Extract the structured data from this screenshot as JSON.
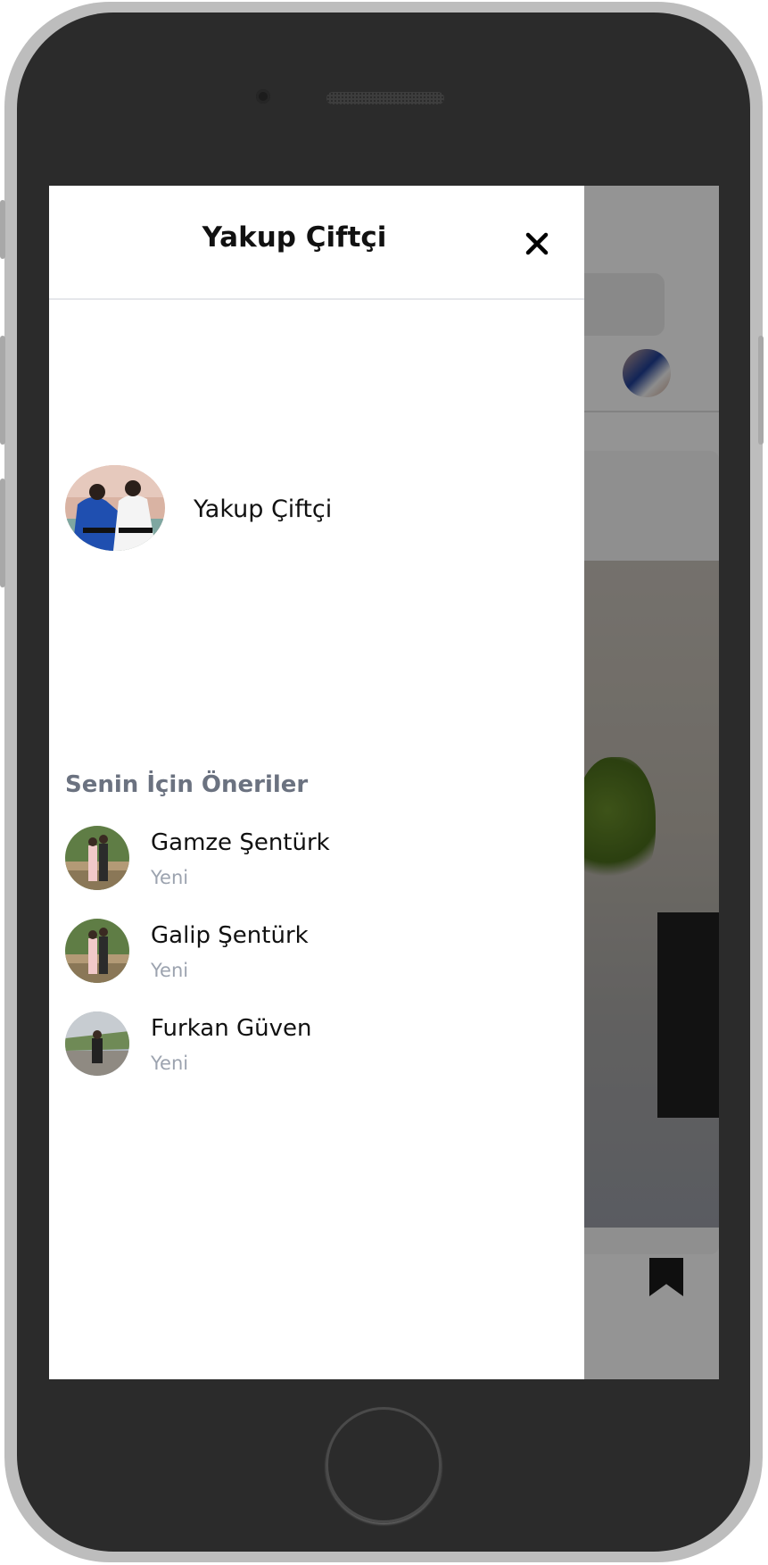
{
  "drawer": {
    "title": "Yakup Çiftçi",
    "close_icon": "close-icon"
  },
  "profile": {
    "name": "Yakup Çiftçi",
    "avatar": "judo-avatar"
  },
  "suggestions": {
    "title": "Senin İçin Öneriler",
    "items": [
      {
        "name": "Gamze Şentürk",
        "status": "Yeni"
      },
      {
        "name": "Galip Şentürk",
        "status": "Yeni"
      },
      {
        "name": "Furkan Güven",
        "status": "Yeni"
      }
    ]
  },
  "background": {
    "bookmark_icon": "bookmark-icon"
  },
  "colors": {
    "overlay": "#000000",
    "section_title": "#6b7280",
    "muted": "#9ca3af",
    "frame": "#2b2b2b"
  }
}
